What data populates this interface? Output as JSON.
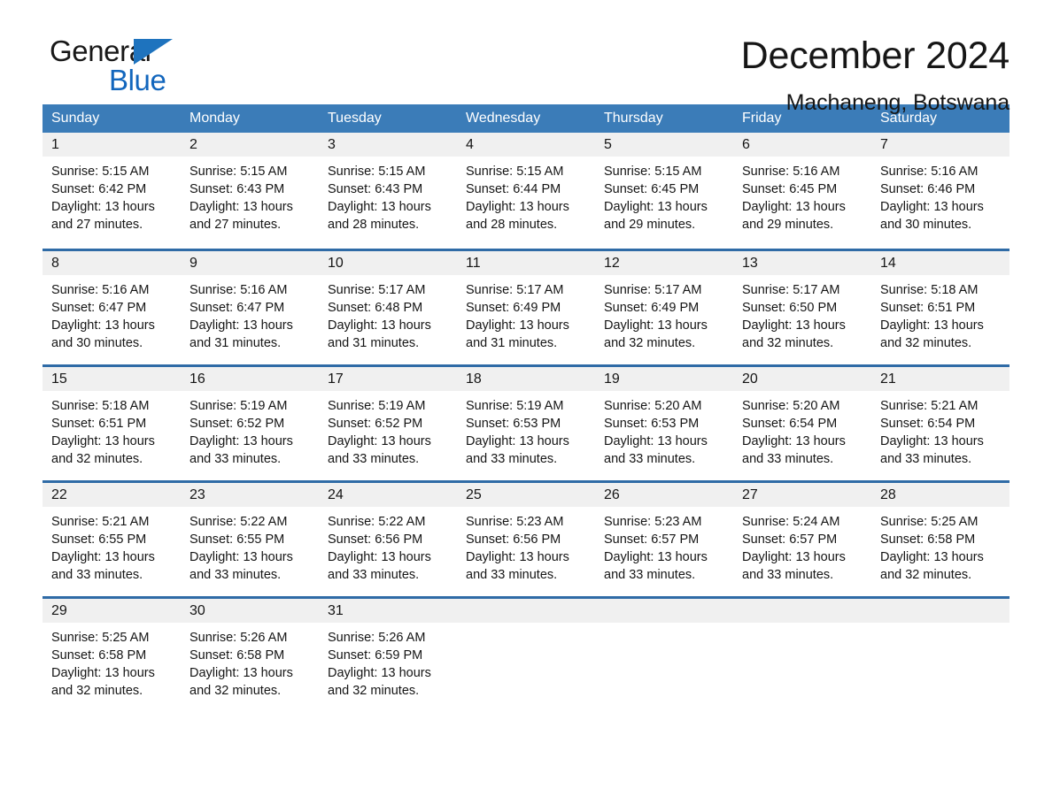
{
  "brand": {
    "name_part1": "General",
    "name_part2": "Blue",
    "logo_icon": "triangle-flag-icon",
    "accent_color": "#1266bd"
  },
  "header": {
    "title": "December 2024",
    "subtitle": "Machaneng, Botswana"
  },
  "theme": {
    "header_row_bg": "#3b7cb8",
    "row_divider": "#2f6ba6",
    "day_number_strip_bg": "#f0f0f0",
    "text_color": "#151515"
  },
  "calendar": {
    "day_names": [
      "Sunday",
      "Monday",
      "Tuesday",
      "Wednesday",
      "Thursday",
      "Friday",
      "Saturday"
    ],
    "weeks": [
      [
        {
          "day": "1",
          "sunrise": "Sunrise: 5:15 AM",
          "sunset": "Sunset: 6:42 PM",
          "daylight1": "Daylight: 13 hours",
          "daylight2": "and 27 minutes."
        },
        {
          "day": "2",
          "sunrise": "Sunrise: 5:15 AM",
          "sunset": "Sunset: 6:43 PM",
          "daylight1": "Daylight: 13 hours",
          "daylight2": "and 27 minutes."
        },
        {
          "day": "3",
          "sunrise": "Sunrise: 5:15 AM",
          "sunset": "Sunset: 6:43 PM",
          "daylight1": "Daylight: 13 hours",
          "daylight2": "and 28 minutes."
        },
        {
          "day": "4",
          "sunrise": "Sunrise: 5:15 AM",
          "sunset": "Sunset: 6:44 PM",
          "daylight1": "Daylight: 13 hours",
          "daylight2": "and 28 minutes."
        },
        {
          "day": "5",
          "sunrise": "Sunrise: 5:15 AM",
          "sunset": "Sunset: 6:45 PM",
          "daylight1": "Daylight: 13 hours",
          "daylight2": "and 29 minutes."
        },
        {
          "day": "6",
          "sunrise": "Sunrise: 5:16 AM",
          "sunset": "Sunset: 6:45 PM",
          "daylight1": "Daylight: 13 hours",
          "daylight2": "and 29 minutes."
        },
        {
          "day": "7",
          "sunrise": "Sunrise: 5:16 AM",
          "sunset": "Sunset: 6:46 PM",
          "daylight1": "Daylight: 13 hours",
          "daylight2": "and 30 minutes."
        }
      ],
      [
        {
          "day": "8",
          "sunrise": "Sunrise: 5:16 AM",
          "sunset": "Sunset: 6:47 PM",
          "daylight1": "Daylight: 13 hours",
          "daylight2": "and 30 minutes."
        },
        {
          "day": "9",
          "sunrise": "Sunrise: 5:16 AM",
          "sunset": "Sunset: 6:47 PM",
          "daylight1": "Daylight: 13 hours",
          "daylight2": "and 31 minutes."
        },
        {
          "day": "10",
          "sunrise": "Sunrise: 5:17 AM",
          "sunset": "Sunset: 6:48 PM",
          "daylight1": "Daylight: 13 hours",
          "daylight2": "and 31 minutes."
        },
        {
          "day": "11",
          "sunrise": "Sunrise: 5:17 AM",
          "sunset": "Sunset: 6:49 PM",
          "daylight1": "Daylight: 13 hours",
          "daylight2": "and 31 minutes."
        },
        {
          "day": "12",
          "sunrise": "Sunrise: 5:17 AM",
          "sunset": "Sunset: 6:49 PM",
          "daylight1": "Daylight: 13 hours",
          "daylight2": "and 32 minutes."
        },
        {
          "day": "13",
          "sunrise": "Sunrise: 5:17 AM",
          "sunset": "Sunset: 6:50 PM",
          "daylight1": "Daylight: 13 hours",
          "daylight2": "and 32 minutes."
        },
        {
          "day": "14",
          "sunrise": "Sunrise: 5:18 AM",
          "sunset": "Sunset: 6:51 PM",
          "daylight1": "Daylight: 13 hours",
          "daylight2": "and 32 minutes."
        }
      ],
      [
        {
          "day": "15",
          "sunrise": "Sunrise: 5:18 AM",
          "sunset": "Sunset: 6:51 PM",
          "daylight1": "Daylight: 13 hours",
          "daylight2": "and 32 minutes."
        },
        {
          "day": "16",
          "sunrise": "Sunrise: 5:19 AM",
          "sunset": "Sunset: 6:52 PM",
          "daylight1": "Daylight: 13 hours",
          "daylight2": "and 33 minutes."
        },
        {
          "day": "17",
          "sunrise": "Sunrise: 5:19 AM",
          "sunset": "Sunset: 6:52 PM",
          "daylight1": "Daylight: 13 hours",
          "daylight2": "and 33 minutes."
        },
        {
          "day": "18",
          "sunrise": "Sunrise: 5:19 AM",
          "sunset": "Sunset: 6:53 PM",
          "daylight1": "Daylight: 13 hours",
          "daylight2": "and 33 minutes."
        },
        {
          "day": "19",
          "sunrise": "Sunrise: 5:20 AM",
          "sunset": "Sunset: 6:53 PM",
          "daylight1": "Daylight: 13 hours",
          "daylight2": "and 33 minutes."
        },
        {
          "day": "20",
          "sunrise": "Sunrise: 5:20 AM",
          "sunset": "Sunset: 6:54 PM",
          "daylight1": "Daylight: 13 hours",
          "daylight2": "and 33 minutes."
        },
        {
          "day": "21",
          "sunrise": "Sunrise: 5:21 AM",
          "sunset": "Sunset: 6:54 PM",
          "daylight1": "Daylight: 13 hours",
          "daylight2": "and 33 minutes."
        }
      ],
      [
        {
          "day": "22",
          "sunrise": "Sunrise: 5:21 AM",
          "sunset": "Sunset: 6:55 PM",
          "daylight1": "Daylight: 13 hours",
          "daylight2": "and 33 minutes."
        },
        {
          "day": "23",
          "sunrise": "Sunrise: 5:22 AM",
          "sunset": "Sunset: 6:55 PM",
          "daylight1": "Daylight: 13 hours",
          "daylight2": "and 33 minutes."
        },
        {
          "day": "24",
          "sunrise": "Sunrise: 5:22 AM",
          "sunset": "Sunset: 6:56 PM",
          "daylight1": "Daylight: 13 hours",
          "daylight2": "and 33 minutes."
        },
        {
          "day": "25",
          "sunrise": "Sunrise: 5:23 AM",
          "sunset": "Sunset: 6:56 PM",
          "daylight1": "Daylight: 13 hours",
          "daylight2": "and 33 minutes."
        },
        {
          "day": "26",
          "sunrise": "Sunrise: 5:23 AM",
          "sunset": "Sunset: 6:57 PM",
          "daylight1": "Daylight: 13 hours",
          "daylight2": "and 33 minutes."
        },
        {
          "day": "27",
          "sunrise": "Sunrise: 5:24 AM",
          "sunset": "Sunset: 6:57 PM",
          "daylight1": "Daylight: 13 hours",
          "daylight2": "and 33 minutes."
        },
        {
          "day": "28",
          "sunrise": "Sunrise: 5:25 AM",
          "sunset": "Sunset: 6:58 PM",
          "daylight1": "Daylight: 13 hours",
          "daylight2": "and 32 minutes."
        }
      ],
      [
        {
          "day": "29",
          "sunrise": "Sunrise: 5:25 AM",
          "sunset": "Sunset: 6:58 PM",
          "daylight1": "Daylight: 13 hours",
          "daylight2": "and 32 minutes."
        },
        {
          "day": "30",
          "sunrise": "Sunrise: 5:26 AM",
          "sunset": "Sunset: 6:58 PM",
          "daylight1": "Daylight: 13 hours",
          "daylight2": "and 32 minutes."
        },
        {
          "day": "31",
          "sunrise": "Sunrise: 5:26 AM",
          "sunset": "Sunset: 6:59 PM",
          "daylight1": "Daylight: 13 hours",
          "daylight2": "and 32 minutes."
        },
        {
          "day": "",
          "sunrise": "",
          "sunset": "",
          "daylight1": "",
          "daylight2": ""
        },
        {
          "day": "",
          "sunrise": "",
          "sunset": "",
          "daylight1": "",
          "daylight2": ""
        },
        {
          "day": "",
          "sunrise": "",
          "sunset": "",
          "daylight1": "",
          "daylight2": ""
        },
        {
          "day": "",
          "sunrise": "",
          "sunset": "",
          "daylight1": "",
          "daylight2": ""
        }
      ]
    ]
  }
}
